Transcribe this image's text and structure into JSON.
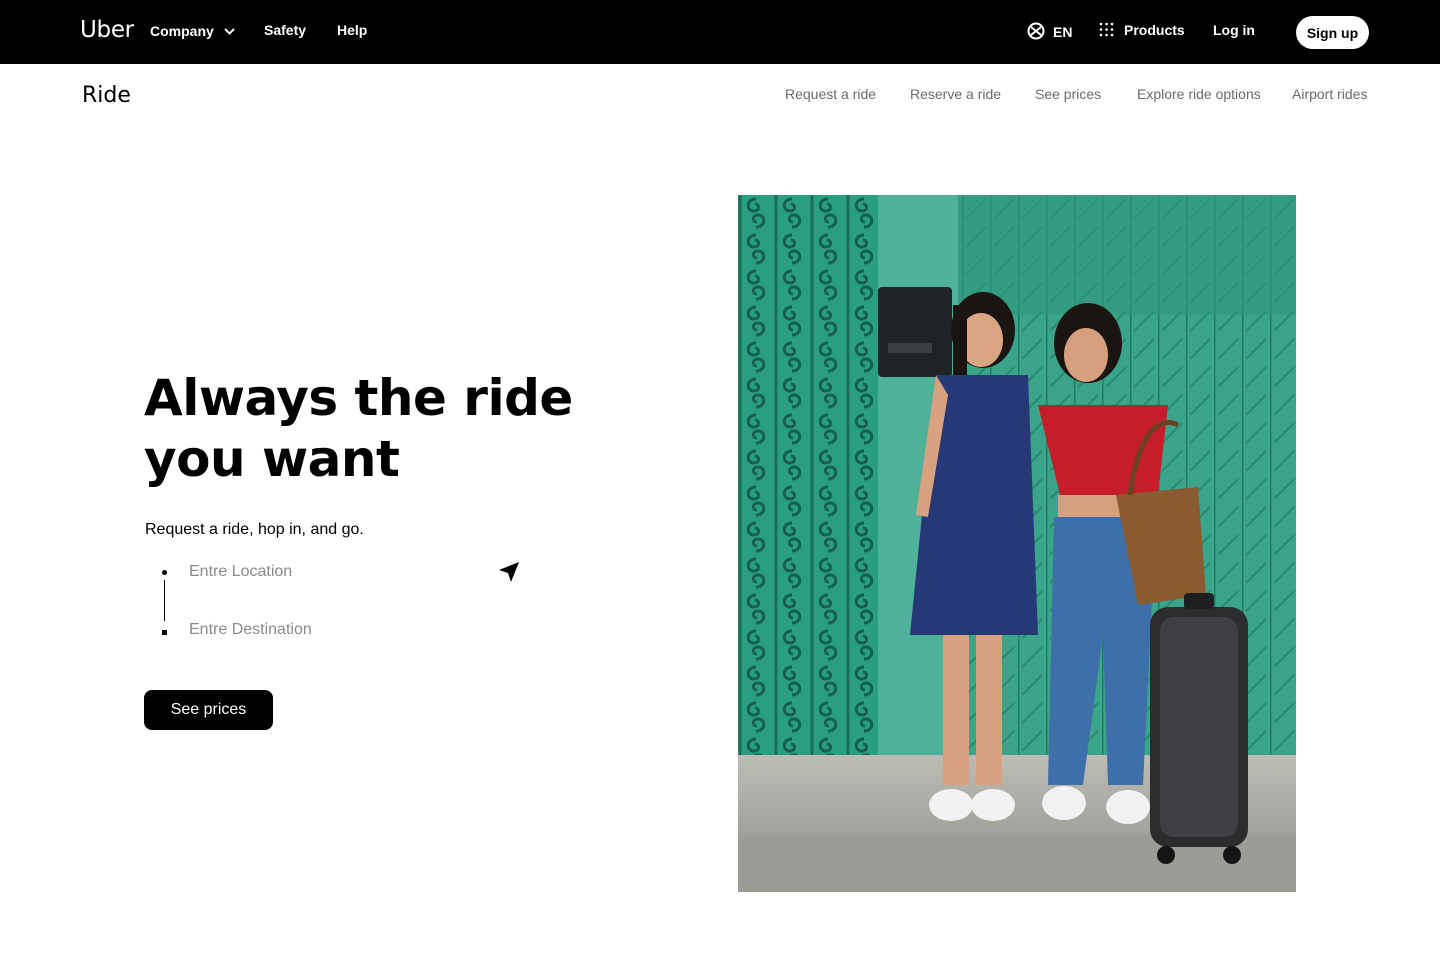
{
  "header": {
    "logo": "Uber",
    "nav": {
      "company": "Company",
      "safety": "Safety",
      "help": "Help"
    },
    "language": "EN",
    "products": "Products",
    "login": "Log in",
    "signup": "Sign up"
  },
  "subnav": {
    "title": "Ride",
    "links": [
      "Request a ride",
      "Reserve a ride",
      "See prices",
      "Explore ride options",
      "Airport rides"
    ]
  },
  "hero": {
    "title": "Always the ride you want",
    "subtitle": "Request a ride, hop in, and go.",
    "location_placeholder": "Entre Location",
    "destination_placeholder": "Entre Destination",
    "cta": "See prices"
  },
  "icons": {
    "chevron": "chevron-down-icon",
    "globe": "globe-icon",
    "grid": "grid-icon",
    "locate": "navigation-arrow-icon"
  },
  "colors": {
    "header_bg": "#000000",
    "subnav_text": "#6b6b6b",
    "placeholder": "#8a8a8a",
    "cta_bg": "#000000"
  }
}
